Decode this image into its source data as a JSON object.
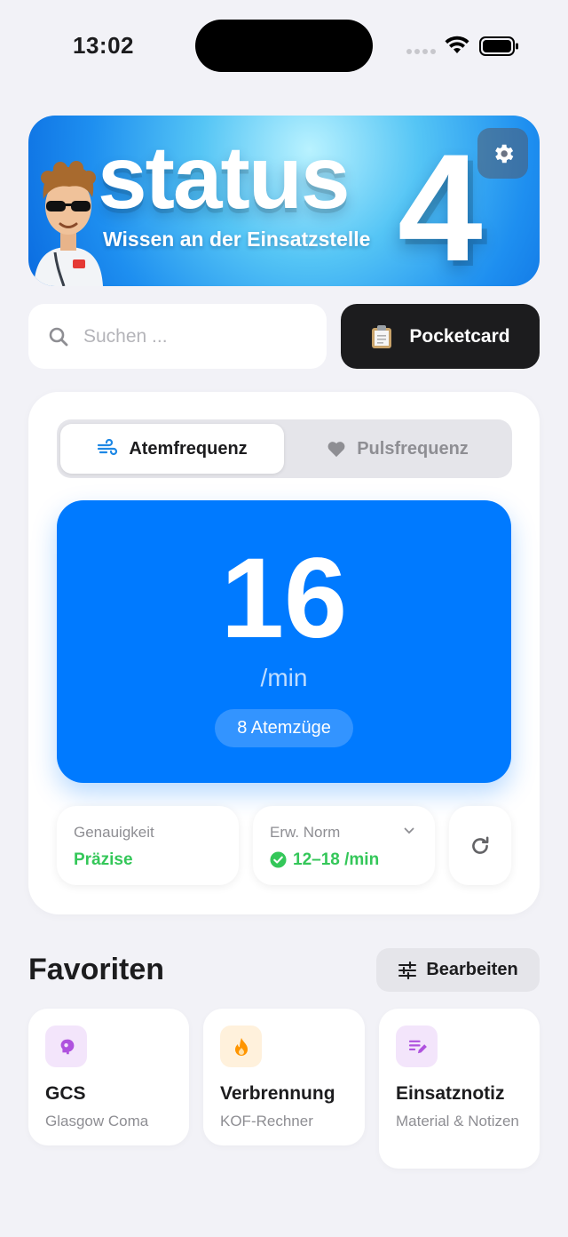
{
  "status_bar": {
    "time": "13:02"
  },
  "banner": {
    "word": "status",
    "digit": "4",
    "tagline": "Wissen an der Einsatzstelle",
    "settings_icon": "gear-icon"
  },
  "search": {
    "placeholder": "Suchen ...",
    "value": ""
  },
  "pocketcard": {
    "label": "Pocketcard",
    "icon": "clipboard-icon"
  },
  "segments": [
    {
      "label": "Atemfrequenz",
      "icon": "wind-icon",
      "selected": true
    },
    {
      "label": "Pulsfrequenz",
      "icon": "heart-icon",
      "selected": false
    }
  ],
  "rate": {
    "value": "16",
    "unit": "/min",
    "count_label": "8 Atemzüge",
    "color": "#007AFF"
  },
  "accuracy": {
    "label": "Genauigkeit",
    "value": "Präzise"
  },
  "norm": {
    "label": "Erw. Norm",
    "value": "12–18 /min"
  },
  "colors": {
    "success": "#34C759",
    "accent": "#007AFF"
  },
  "favorites": {
    "title": "Favoriten",
    "edit_label": "Bearbeiten",
    "items": [
      {
        "name": "GCS",
        "subtitle": "Glasgow Coma",
        "icon": "brain-icon",
        "color": "#AF52DE"
      },
      {
        "name": "Verbrennung",
        "subtitle": "KOF-Rechner",
        "icon": "flame-icon",
        "color": "#FF9500"
      },
      {
        "name": "Einsatznotiz",
        "subtitle": "Material & Notizen",
        "icon": "note-edit-icon",
        "color": "#AF52DE"
      }
    ]
  }
}
